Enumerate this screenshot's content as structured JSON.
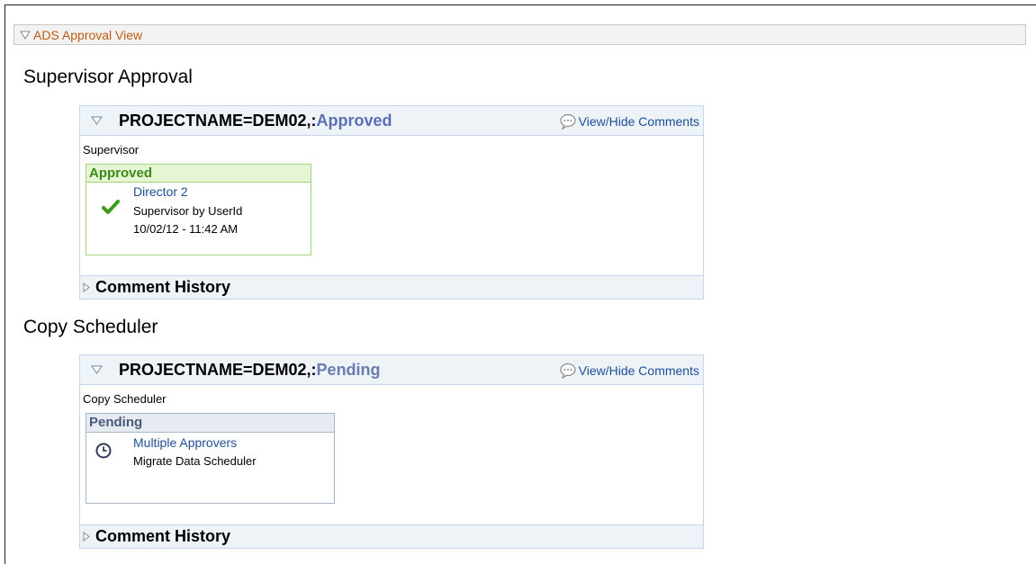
{
  "group": {
    "title": "ADS Approval View"
  },
  "sections": [
    {
      "title": "Supervisor Approval",
      "panel": {
        "project": "PROJECTNAME=DEM02,:",
        "status": "Approved",
        "view_hide": "View/Hide Comments",
        "stage_label": "Supervisor",
        "box": {
          "heading": "Approved",
          "approver": "Director 2",
          "lines": [
            "Supervisor by UserId",
            "10/02/12 - 11:42 AM"
          ],
          "icon": "checkmark-icon"
        },
        "comment_history": "Comment History"
      }
    },
    {
      "title": "Copy Scheduler",
      "panel": {
        "project": "PROJECTNAME=DEM02,:",
        "status": "Pending",
        "view_hide": "View/Hide Comments",
        "stage_label": "Copy Scheduler",
        "box": {
          "heading": "Pending",
          "approver": "Multiple Approvers",
          "lines": [
            "Migrate Data Scheduler"
          ],
          "icon": "clock-icon"
        },
        "comment_history": "Comment History"
      }
    }
  ],
  "colors": {
    "link": "#1f4f96",
    "group_title": "#c05a12",
    "approved_status": "#5b6fb8",
    "approved_heading": "#3b8a1a",
    "pending_heading": "#4a5b79"
  }
}
